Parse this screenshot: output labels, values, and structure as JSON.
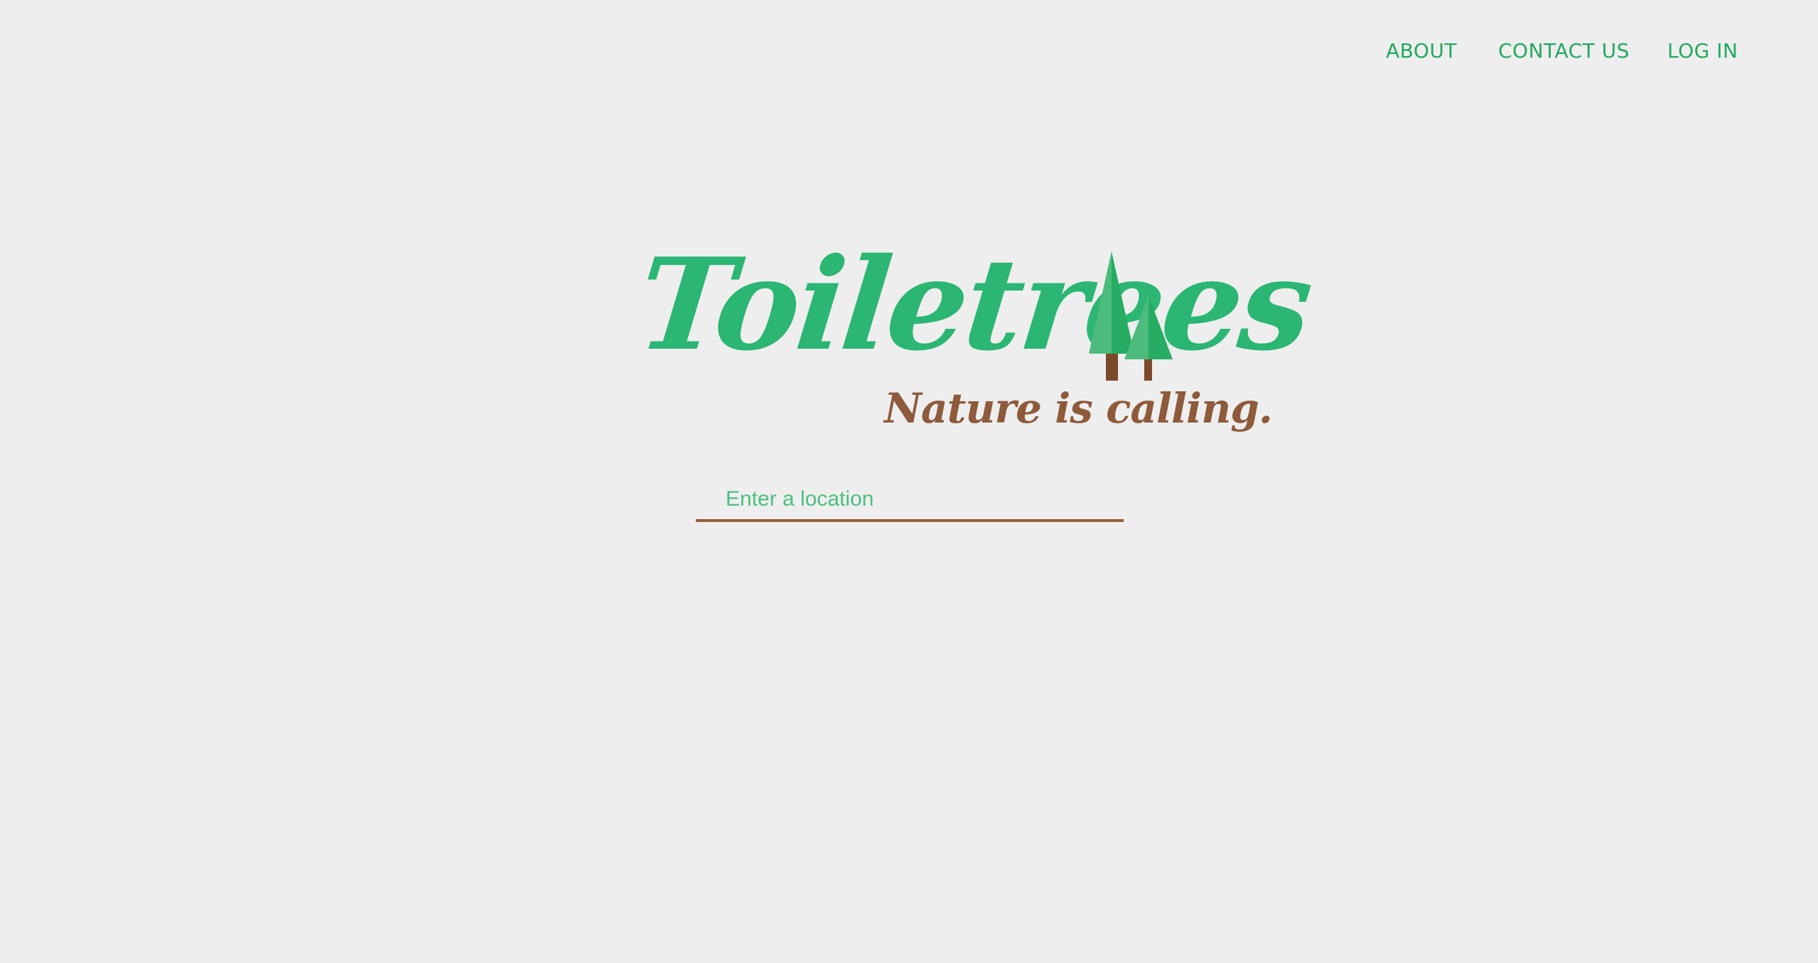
{
  "nav": {
    "about": "ABOUT",
    "contact": "CONTACT US",
    "login": "LOG IN"
  },
  "logo": {
    "wordmark": "Toiletrees",
    "tagline": "Nature is calling.",
    "icon": "trees-icon"
  },
  "search": {
    "placeholder": "Enter a location",
    "value": ""
  },
  "colors": {
    "background": "#eeeeee",
    "brand_green": "#2bb673",
    "brand_brown": "#8e5a3b"
  }
}
